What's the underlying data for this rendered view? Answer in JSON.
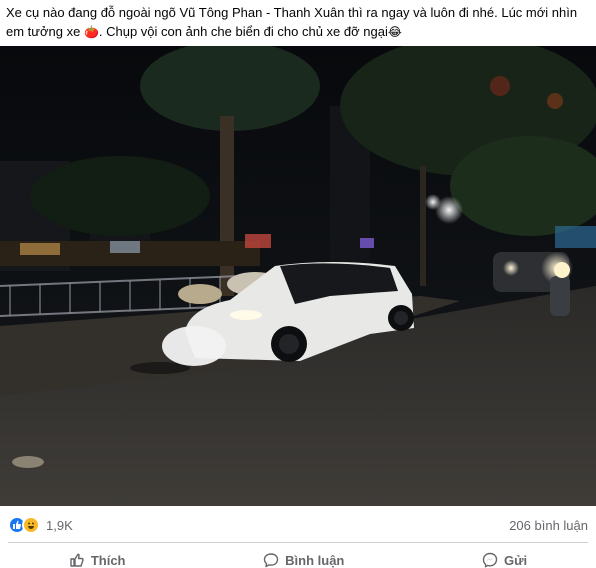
{
  "post": {
    "text_part1": "Xe cụ nào đang đỗ ngoài ngõ Vũ Tông Phan - Thanh Xuân thì ra ngay và luôn đi nhé. Lúc mới nhìn em tưởng xe ",
    "emoji1": "🍅",
    "text_part2": ". Chụp vội con ảnh che biển đi cho chủ xe đỡ ngại",
    "emoji2": "😂"
  },
  "reactions": {
    "icons": [
      "like-icon",
      "haha-icon"
    ],
    "count": "1,9K",
    "comments": "206 bình luận"
  },
  "actions": {
    "like_label": "Thích",
    "comment_label": "Bình luận",
    "send_label": "Gửi"
  },
  "colors": {
    "like_blue": "#1877f2",
    "haha_yellow": "#f7b928",
    "muted_text": "#65676b"
  }
}
